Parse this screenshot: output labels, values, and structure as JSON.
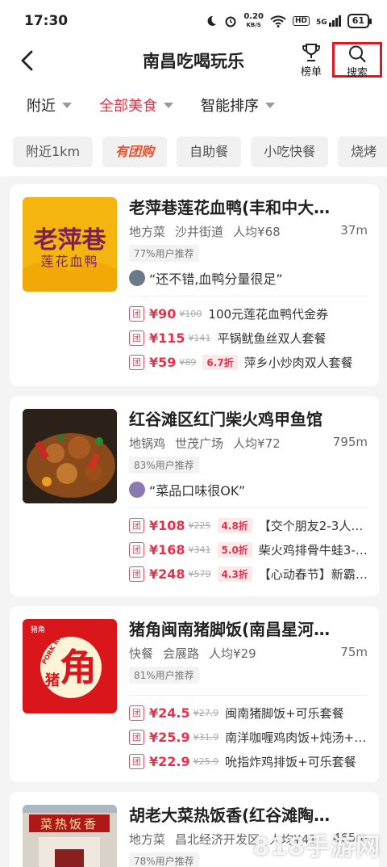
{
  "status": {
    "time": "17:30",
    "net_speed": "0.20",
    "net_unit": "KB/S",
    "hd": "HD",
    "signal": "5G",
    "battery": "61"
  },
  "header": {
    "title": "南昌吃喝玩乐",
    "rank_label": "榜单",
    "search_label": "搜索"
  },
  "filters": [
    {
      "label": "附近",
      "active": false
    },
    {
      "label": "全部美食",
      "active": true
    },
    {
      "label": "智能排序",
      "active": false
    }
  ],
  "chips": [
    "附近1km",
    "有团购",
    "自助餐",
    "小吃快餐",
    "烧烤"
  ],
  "restaurants": [
    {
      "name": "老萍巷莲花血鸭(丰和中大…",
      "cuisine": "地方菜",
      "area": "沙井街道",
      "avg": "人均¥68",
      "distance": "37m",
      "recommend": "77%用户推荐",
      "review": "“还不错,血鸭分量很足”",
      "logo_text": "老萍巷",
      "logo_sub": "莲花血鸭",
      "deals": [
        {
          "tag": "团",
          "price": "¥90",
          "orig": "¥100",
          "discount": "",
          "name": "100元莲花血鸭代金券"
        },
        {
          "tag": "团",
          "price": "¥115",
          "orig": "¥141",
          "discount": "",
          "name": "平锅鱿鱼丝双人套餐"
        },
        {
          "tag": "团",
          "price": "¥59",
          "orig": "¥89",
          "discount": "6.7折",
          "name": "萍乡小炒肉双人套餐"
        }
      ]
    },
    {
      "name": "红谷滩区红门柴火鸡甲鱼馆",
      "cuisine": "地锅鸡",
      "area": "世茂广场",
      "avg": "人均¥72",
      "distance": "795m",
      "recommend": "83%用户推荐",
      "review": "“菜品口味很OK”",
      "deals": [
        {
          "tag": "团",
          "price": "¥108",
          "orig": "¥225",
          "discount": "4.8折",
          "name": "【交个朋友2-3人餐】…"
        },
        {
          "tag": "团",
          "price": "¥168",
          "orig": "¥341",
          "discount": "5.0折",
          "name": "柴火鸡排骨牛蛙3-4人…"
        },
        {
          "tag": "团",
          "price": "¥248",
          "orig": "¥579",
          "discount": "4.3折",
          "name": "【心动春节】新霸王…"
        }
      ]
    },
    {
      "name": "猪角闽南猪脚饭(南昌星河…",
      "cuisine": "快餐",
      "area": "会展路",
      "avg": "人均¥29",
      "distance": "75m",
      "recommend": "81%用户推荐",
      "review": "",
      "logo_text": "角",
      "logo_side": "猪",
      "logo_top": "PORK RICE",
      "logo_brand": "猪角",
      "deals": [
        {
          "tag": "团",
          "price": "¥24.5",
          "orig": "¥27.9",
          "discount": "",
          "name": "闽南猪脚饭+可乐套餐"
        },
        {
          "tag": "团",
          "price": "¥25.9",
          "orig": "¥31.9",
          "discount": "",
          "name": "南洋咖喱鸡肉饭+炖汤+可…"
        },
        {
          "tag": "团",
          "price": "¥22.9",
          "orig": "¥25.9",
          "discount": "",
          "name": "吮指炸鸡排饭+可乐套餐"
        }
      ]
    },
    {
      "name": "胡老大菜热饭香(红谷滩陶…",
      "cuisine": "地方菜",
      "area": "昌北经济开发区",
      "avg": "人均¥41",
      "distance": "465m",
      "recommend": "78%用户推荐",
      "review": "",
      "sign_text": "菜热饭香",
      "deals": []
    }
  ],
  "watermark": "818手游网",
  "colors": {
    "accent": "#e0304a",
    "highlight_box": "#e0161e",
    "price": "#e8304a"
  }
}
